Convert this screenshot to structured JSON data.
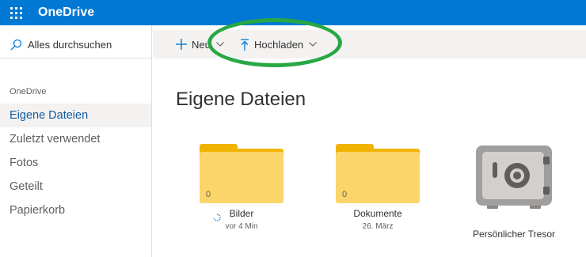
{
  "app": {
    "title": "OneDrive"
  },
  "search": {
    "placeholder": "Alles durchsuchen"
  },
  "sidebar": {
    "heading": "OneDrive",
    "items": [
      {
        "label": "Eigene Dateien",
        "active": true
      },
      {
        "label": "Zuletzt verwendet",
        "active": false
      },
      {
        "label": "Fotos",
        "active": false
      },
      {
        "label": "Geteilt",
        "active": false
      },
      {
        "label": "Papierkorb",
        "active": false
      }
    ]
  },
  "commandbar": {
    "new_label": "Neu",
    "upload_label": "Hochladen"
  },
  "main": {
    "title": "Eigene Dateien",
    "items": [
      {
        "name": "Bilder",
        "sub": "vor 4 Min",
        "count": "0",
        "icon": "folder-icon"
      },
      {
        "name": "Dokumente",
        "sub": "26. März",
        "count": "0",
        "icon": "folder-icon"
      },
      {
        "name": "Persönlicher Tresor",
        "icon": "vault-icon"
      }
    ]
  },
  "colors": {
    "brand": "#0078d4",
    "accent_text": "#0f5c9e",
    "folder": "#fcd56a",
    "highlight": "#27a844"
  }
}
